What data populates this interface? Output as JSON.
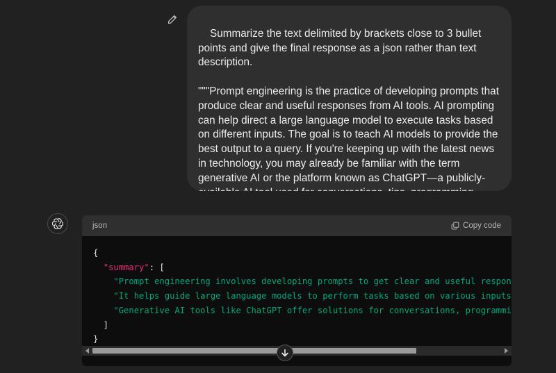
{
  "user_message": {
    "text": "Summarize the text delimited by brackets close to 3 bullet points and give the final response as a json rather than text description.\n\n\"\"\"Prompt engineering is the practice of developing prompts that produce clear and useful responses from AI tools. AI prompting can help direct a large language model to execute tasks based on different inputs. The goal is to teach AI models to provide the best output to a query. If you're keeping up with the latest news in technology, you may already be familiar with the term generative AI or the platform known as ChatGPT—a publicly-available AI tool used for conversations, tips, programming assistance, and even automated solutions. \"\"\""
  },
  "icons": {
    "edit": "pencil-icon",
    "avatar": "openai-logo-icon",
    "copy": "copy-icon",
    "scroll_down": "arrow-down-icon",
    "scroll_left": "triangle-left-icon",
    "scroll_right": "triangle-right-icon"
  },
  "code_block": {
    "language": "json",
    "copy_label": "Copy code",
    "lines": {
      "open_brace": "{",
      "key_indent": "  ",
      "key": "\"summary\"",
      "key_after": ": [",
      "item_indent": "    ",
      "item1": "\"Prompt engineering involves developing prompts to get clear and useful responses from",
      "item2": "\"It helps guide large language models to perform tasks based on various inputs.\"",
      "item2_after": ",",
      "item3": "\"Generative AI tools like ChatGPT offer solutions for conversations, programming help,",
      "close_bracket": "  ]",
      "close_brace": "}"
    },
    "scroll_position": 0.78
  },
  "colors": {
    "background": "#212121",
    "bubble": "#2f2f2f",
    "code_bg": "#0d0d0d",
    "code_header": "#2f2f2f",
    "json_key": "#df3079",
    "json_string": "#00a67d"
  }
}
